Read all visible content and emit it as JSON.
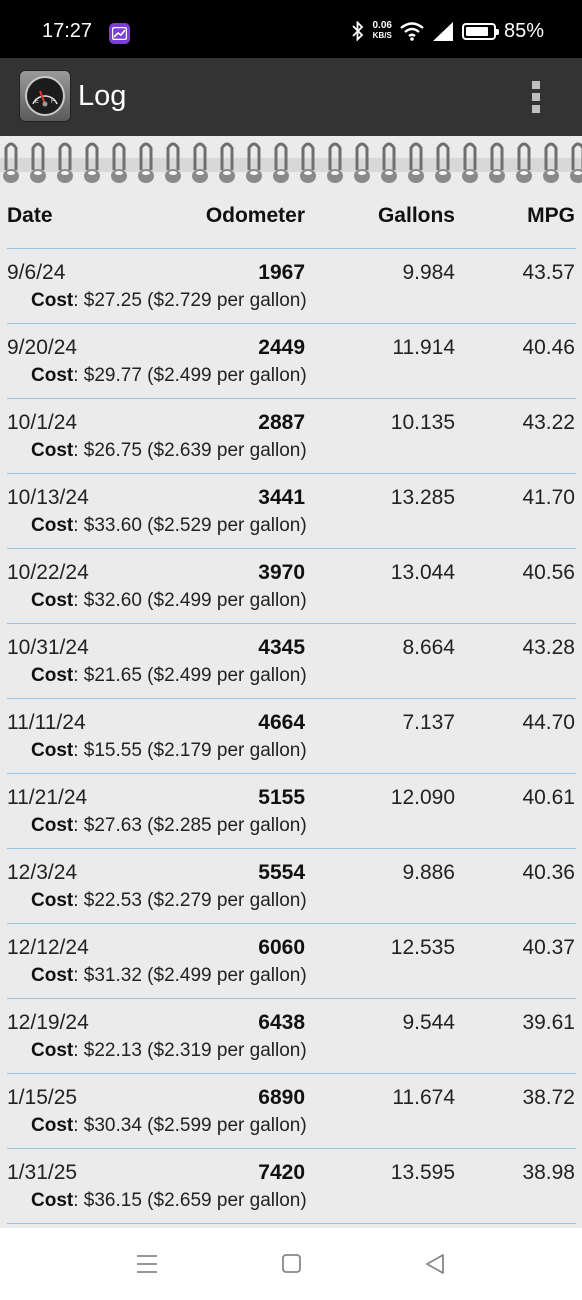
{
  "status_bar": {
    "time": "17:27",
    "net_speed_value": "0.06",
    "net_speed_unit": "KB/S",
    "battery_text": "85%",
    "battery_level": 0.85
  },
  "action_bar": {
    "title": "Log",
    "overflow_icon": "overflow-menu-icon"
  },
  "table": {
    "headers": {
      "date": "Date",
      "odometer": "Odometer",
      "gallons": "Gallons",
      "mpg": "MPG"
    },
    "cost_label": "Cost",
    "rows": [
      {
        "date": "9/6/24",
        "odometer": "1967",
        "gallons": "9.984",
        "mpg": "43.57",
        "cost": ": $27.25 ($2.729 per gallon)"
      },
      {
        "date": "9/20/24",
        "odometer": "2449",
        "gallons": "11.914",
        "mpg": "40.46",
        "cost": ": $29.77 ($2.499 per gallon)"
      },
      {
        "date": "10/1/24",
        "odometer": "2887",
        "gallons": "10.135",
        "mpg": "43.22",
        "cost": ": $26.75 ($2.639 per gallon)"
      },
      {
        "date": "10/13/24",
        "odometer": "3441",
        "gallons": "13.285",
        "mpg": "41.70",
        "cost": ": $33.60 ($2.529 per gallon)"
      },
      {
        "date": "10/22/24",
        "odometer": "3970",
        "gallons": "13.044",
        "mpg": "40.56",
        "cost": ": $32.60 ($2.499 per gallon)"
      },
      {
        "date": "10/31/24",
        "odometer": "4345",
        "gallons": "8.664",
        "mpg": "43.28",
        "cost": ": $21.65 ($2.499 per gallon)"
      },
      {
        "date": "11/11/24",
        "odometer": "4664",
        "gallons": "7.137",
        "mpg": "44.70",
        "cost": ": $15.55 ($2.179 per gallon)"
      },
      {
        "date": "11/21/24",
        "odometer": "5155",
        "gallons": "12.090",
        "mpg": "40.61",
        "cost": ": $27.63 ($2.285 per gallon)"
      },
      {
        "date": "12/3/24",
        "odometer": "5554",
        "gallons": "9.886",
        "mpg": "40.36",
        "cost": ": $22.53 ($2.279 per gallon)"
      },
      {
        "date": "12/12/24",
        "odometer": "6060",
        "gallons": "12.535",
        "mpg": "40.37",
        "cost": ": $31.32 ($2.499 per gallon)"
      },
      {
        "date": "12/19/24",
        "odometer": "6438",
        "gallons": "9.544",
        "mpg": "39.61",
        "cost": ": $22.13 ($2.319 per gallon)"
      },
      {
        "date": "1/15/25",
        "odometer": "6890",
        "gallons": "11.674",
        "mpg": "38.72",
        "cost": ": $30.34 ($2.599 per gallon)"
      },
      {
        "date": "1/31/25",
        "odometer": "7420",
        "gallons": "13.595",
        "mpg": "38.98",
        "cost": ": $36.15 ($2.659 per gallon)"
      }
    ]
  },
  "colors": {
    "status_bar_bg": "#000000",
    "action_bar_bg": "#333333",
    "paper_bg": "#ebebeb",
    "row_divider": "#9bc5e0",
    "nav_bar_bg": "#ffffff"
  },
  "nav_bar": {
    "icons": [
      "menu-lines-icon",
      "home-square-icon",
      "back-triangle-icon"
    ]
  }
}
